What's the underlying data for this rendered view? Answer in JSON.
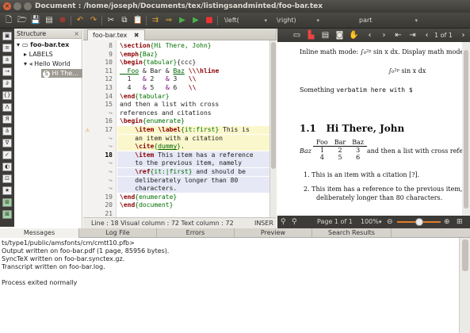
{
  "window": {
    "title": "Document : /home/joseph/Documents/tex/listingsandminted/foo-bar.tex",
    "close_glyph": "×"
  },
  "toolbar": {
    "left_select": "\\left(",
    "right_select": "\\right)",
    "part_select": "part",
    "icons": [
      "new-file",
      "open-file",
      "save-file",
      "save-all",
      "close-file",
      "undo",
      "redo",
      "cut",
      "copy",
      "paste",
      "build-run",
      "quick-build",
      "compile",
      "view-pdf",
      "stop"
    ]
  },
  "structure": {
    "title": "Structure",
    "close": "×",
    "items": [
      {
        "label": "foo-bar.tex",
        "level": 0,
        "bold": true,
        "expander": "▾"
      },
      {
        "label": "LABELS",
        "level": 1,
        "bold": false,
        "expander": "▸"
      },
      {
        "label": "Hello World",
        "level": 1,
        "bold": false,
        "expander": "▾",
        "marker": "1"
      },
      {
        "label": "Hi The...",
        "level": 2,
        "bold": false,
        "expander": "",
        "marker": "S",
        "selected": true
      }
    ]
  },
  "editor": {
    "tab_label": "foo-bar.tex",
    "tab_close": "✖",
    "lines": [
      {
        "n": "8",
        "cls": "",
        "parts": [
          [
            "kw",
            "\\section"
          ],
          [
            "ar",
            "{Hi There, John}"
          ]
        ]
      },
      {
        "n": "9",
        "cls": "",
        "parts": [
          [
            "kw",
            "\\emph"
          ],
          [
            "ar",
            "{Baz}"
          ]
        ]
      },
      {
        "n": "10",
        "cls": "",
        "parts": [
          [
            "kw",
            "\\begin"
          ],
          [
            "ar",
            "{tabular}"
          ],
          [
            "",
            "{ccc}"
          ]
        ]
      },
      {
        "n": "11",
        "cls": "",
        "parts": [
          [
            "lnk",
            "  Foo"
          ],
          [
            "",
            " & Bar & "
          ],
          [
            "lnk",
            "Baz"
          ],
          [
            "",
            " "
          ],
          [
            "kw",
            "\\\\\\hline"
          ]
        ]
      },
      {
        "n": "12",
        "cls": "",
        "parts": [
          [
            "",
            "  1   "
          ],
          [
            "mth",
            "&"
          ],
          [
            "",
            " 2   "
          ],
          [
            "mth",
            "&"
          ],
          [
            "",
            " 3   "
          ],
          [
            "kw",
            "\\\\"
          ]
        ]
      },
      {
        "n": "13",
        "cls": "",
        "parts": [
          [
            "",
            "  4   "
          ],
          [
            "mth",
            "&"
          ],
          [
            "",
            " 5   "
          ],
          [
            "mth",
            "&"
          ],
          [
            "",
            " 6   "
          ],
          [
            "kw",
            "\\\\"
          ]
        ]
      },
      {
        "n": "14",
        "cls": "",
        "parts": [
          [
            "kw",
            "\\end"
          ],
          [
            "ar",
            "{tabular}"
          ]
        ]
      },
      {
        "n": "15",
        "cls": "",
        "parts": [
          [
            "",
            "and then a list with cross"
          ]
        ]
      },
      {
        "n": "↪",
        "cls": "wrap",
        "parts": [
          [
            "",
            "references and citations"
          ]
        ]
      },
      {
        "n": "16",
        "cls": "",
        "parts": [
          [
            "kw",
            "\\begin"
          ],
          [
            "ar",
            "{enumerate}"
          ]
        ]
      },
      {
        "n": "17",
        "cls": "hl-y",
        "warn": true,
        "parts": [
          [
            "",
            "    "
          ],
          [
            "kw",
            "\\item"
          ],
          [
            "",
            " "
          ],
          [
            "kw",
            "\\label"
          ],
          [
            "ar",
            "{it:first}"
          ],
          [
            "",
            " This is"
          ]
        ]
      },
      {
        "n": "↪",
        "cls": "hl-y wrap",
        "parts": [
          [
            "",
            "    an item with a citation"
          ]
        ]
      },
      {
        "n": "↪",
        "cls": "hl-y wrap",
        "parts": [
          [
            "",
            "    "
          ],
          [
            "kw",
            "\\cite"
          ],
          [
            "ar",
            "{"
          ],
          [
            "lnk",
            "dummy"
          ],
          [
            "ar",
            "}"
          ],
          [
            "",
            "."
          ]
        ]
      },
      {
        "n": "18",
        "cls": "hl-b cur",
        "parts": [
          [
            "",
            "    "
          ],
          [
            "kw",
            "\\item"
          ],
          [
            "",
            " This item has a reference"
          ]
        ]
      },
      {
        "n": "↪",
        "cls": "hl-b wrap",
        "parts": [
          [
            "",
            "    to the previous item, namely"
          ]
        ]
      },
      {
        "n": "↪",
        "cls": "hl-b wrap",
        "parts": [
          [
            "",
            "    "
          ],
          [
            "kw",
            "\\ref"
          ],
          [
            "ar",
            "{it:|first}"
          ],
          [
            "",
            " and should be"
          ]
        ]
      },
      {
        "n": "↪",
        "cls": "hl-b wrap",
        "parts": [
          [
            "",
            "    deliberately longer than 80"
          ]
        ]
      },
      {
        "n": "↪",
        "cls": "hl-b wrap",
        "parts": [
          [
            "",
            "    characters."
          ]
        ]
      },
      {
        "n": "19",
        "cls": "",
        "parts": [
          [
            "kw",
            "\\end"
          ],
          [
            "ar",
            "{enumerate}"
          ]
        ]
      },
      {
        "n": "20",
        "cls": "",
        "parts": [
          [
            "kw",
            "\\end"
          ],
          [
            "ar",
            "{document}"
          ]
        ]
      },
      {
        "n": "21",
        "cls": "",
        "parts": [
          [
            "",
            ""
          ]
        ]
      }
    ],
    "status": "Line : 18 Visual column : 72 Text column : 72",
    "mode": "INSER"
  },
  "pdf": {
    "page_text": "1 of 1",
    "status_page": "Page 1 of 1",
    "zoom": "100%",
    "lines": {
      "l1": "Inline math mode: ∫₀²ᵖ sin x dx. Display math mode:",
      "l2": "∫₀²ᵖ sin x dx",
      "l3a": "Something ",
      "l3b": "verbatim here with $",
      "h_num": "1.1",
      "h_text": "Hi There, John",
      "tbl_baz": "Baz",
      "tbl_head": [
        "Foo",
        "Bar",
        "Baz"
      ],
      "tbl_r1": [
        "1",
        "2",
        "3"
      ],
      "tbl_r2": [
        "4",
        "5",
        "6"
      ],
      "tbl_after": "and then a list with cross references",
      "item1": "1.  This is an item with a citation [?].",
      "item2a": "2.  This item has a reference to the previous item, namely",
      "item2b": "deliberately longer than 80 characters."
    }
  },
  "messages": {
    "tabs": [
      "Messages",
      "Log File",
      "Errors",
      "Preview",
      "Search Results"
    ],
    "lines": [
      "ts/type1/public/amsfonts/cm/cmtt10.pfb>",
      "Output written on foo-bar.pdf (1 page, 85956 bytes).",
      "SyncTeX written on foo-bar.synctex.gz.",
      "Transcript written on foo-bar.log.",
      "",
      "Process exited normally"
    ]
  }
}
